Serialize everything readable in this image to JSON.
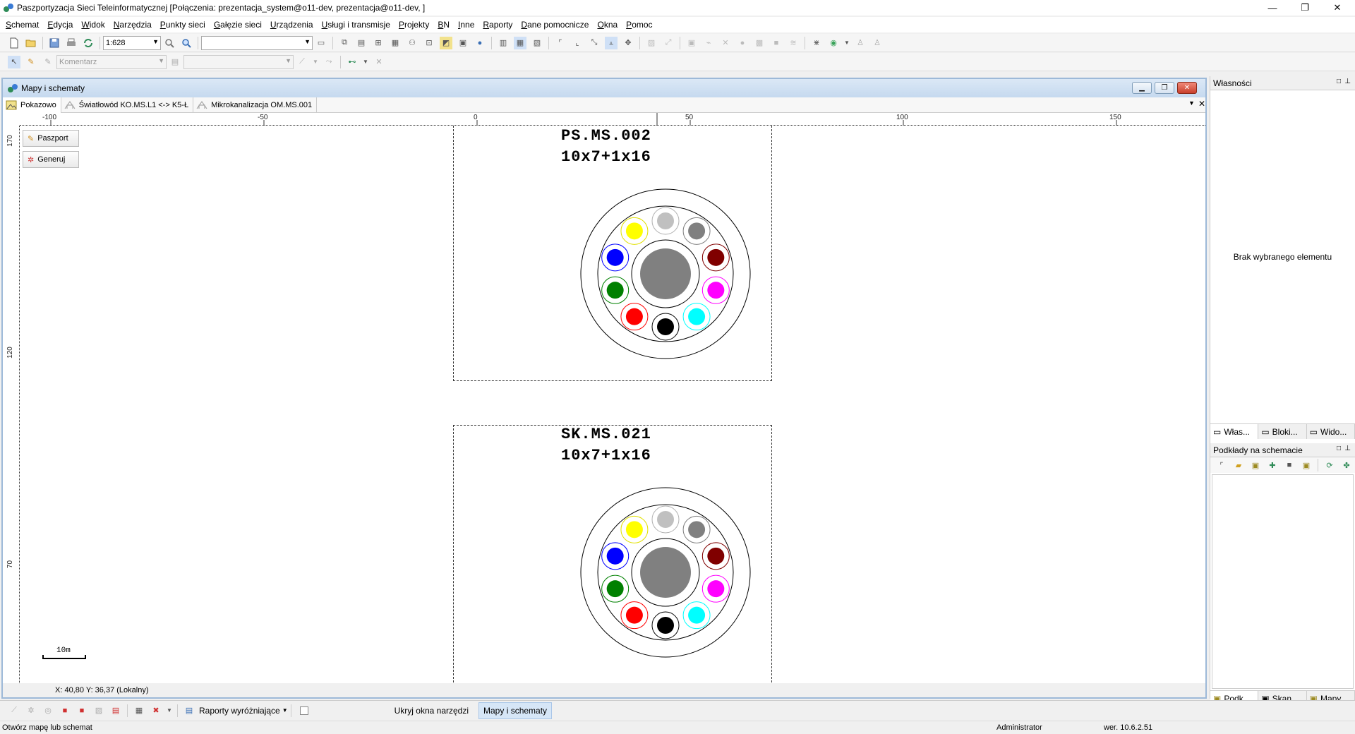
{
  "app": {
    "title": "Paszportyzacja Sieci Teleinformatycznej [Połączenia: prezentacja_system@o11-dev, prezentacja@o11-dev, ]",
    "min": "—",
    "max": "❐",
    "close": "✕"
  },
  "menu": [
    "Schemat",
    "Edycja",
    "Widok",
    "Narzędzia",
    "Punkty sieci",
    "Gałęzie sieci",
    "Urządzenia",
    "Usługi i transmisje",
    "Projekty",
    "BN",
    "Inne",
    "Raporty",
    "Dane pomocnicze",
    "Okna",
    "Pomoc"
  ],
  "toolbar1": {
    "scale_value": "1:628",
    "layer_value": ""
  },
  "toolbar2": {
    "comment_placeholder": "Komentarz",
    "second_value": ""
  },
  "mdi": {
    "title": "Mapy i schematy",
    "tabs": [
      "Pokazowo",
      "Światłowód KO.MS.L1 <-> K5-Ł",
      "Mikrokanalizacja OM.MS.001"
    ]
  },
  "ruler": {
    "h_labels": [
      "-100",
      "-50",
      "0",
      "50",
      "100",
      "150"
    ],
    "v_labels": [
      "170",
      "120",
      "70"
    ]
  },
  "side_buttons": {
    "passport": "Paszport",
    "generate": "Generuj"
  },
  "diagrams": [
    {
      "name": "PS.MS.002",
      "spec": "10x7+1x16"
    },
    {
      "name": "SK.MS.021",
      "spec": "10x7+1x16"
    }
  ],
  "tube_colors": [
    "#c0c0c0",
    "#808080",
    "#800000",
    "#ff00ff",
    "#00ffff",
    "#000000",
    "#ff0000",
    "#008000",
    "#0000ff",
    "#ffff00"
  ],
  "core_color": "#808080",
  "scale_bar": "10m",
  "coords": "X: 40,80  Y: 36,37 (Lokalny)",
  "right_panel": {
    "props_title": "Własności",
    "no_selection": "Brak wybranego elementu",
    "tabs1": [
      "Włas...",
      "Bloki...",
      "Wido..."
    ],
    "layers_title": "Podkłady na schemacie",
    "tabs2": [
      "Podk...",
      "Skan...",
      "Mapy"
    ]
  },
  "bottom": {
    "reports": "Raporty wyróżniające",
    "hide_tools": "Ukryj okna narzędzi",
    "maps_button": "Mapy i schematy"
  },
  "status": {
    "hint": "Otwórz mapę lub schemat",
    "user": "Administrator",
    "version": "wer. 10.6.2.51"
  }
}
